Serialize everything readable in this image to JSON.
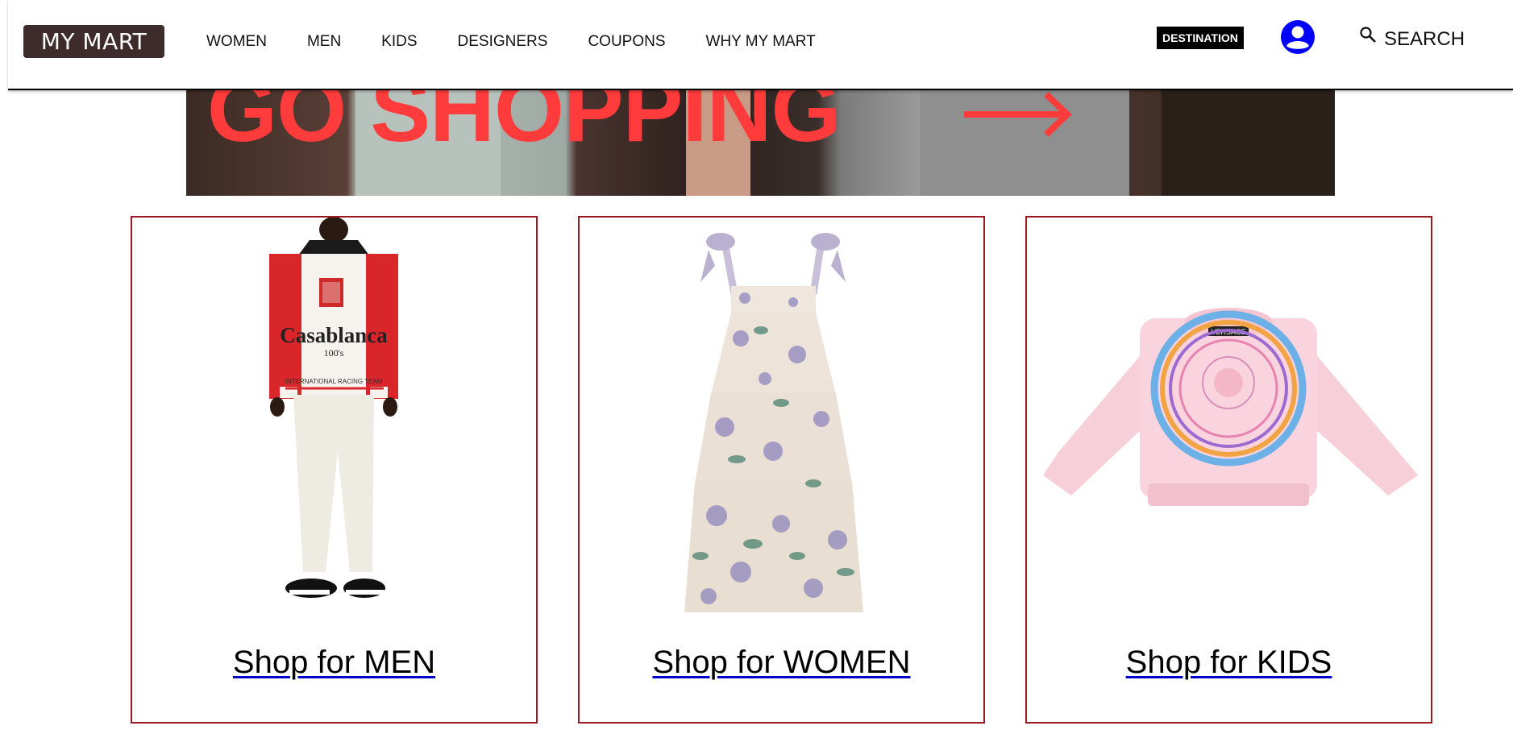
{
  "header": {
    "logo": "MY MART",
    "nav": [
      "WOMEN",
      "MEN",
      "KIDS",
      "DESIGNERS",
      "COUPONS",
      "WHY MY MART"
    ],
    "destination": "DESTINATION",
    "search_label": "SEARCH",
    "icons": [
      "user-account-icon",
      "search-icon"
    ],
    "accent_colors": {
      "logo_bg": "#3e2b2b",
      "user_icon": "#0000ff"
    }
  },
  "banner": {
    "headline": "GO SHOPPING",
    "headline_color": "#ff3b3b"
  },
  "cards": [
    {
      "link": "Shop for MEN",
      "shirt_brand": "Casablanca",
      "shirt_sub": "100's",
      "shirt_strip": "INTERNATIONAL RACING TEAM"
    },
    {
      "link": "Shop for WOMEN"
    },
    {
      "link": "Shop for KIDS",
      "tag": "VERSACE"
    }
  ],
  "card_border_color": "#9b1a22"
}
